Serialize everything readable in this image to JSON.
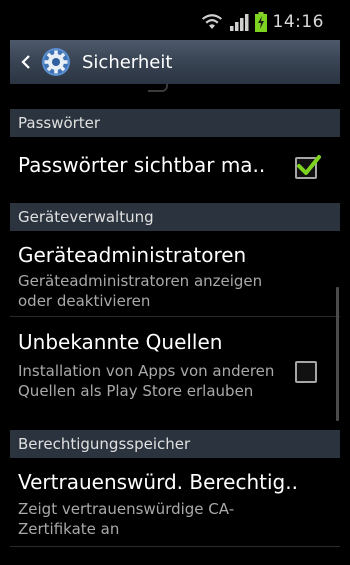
{
  "status_bar": {
    "time": "14:16",
    "icons": [
      "wifi-icon",
      "signal-icon",
      "battery-icon"
    ]
  },
  "action_bar": {
    "title": "Sicherheit",
    "back_icon": "back-icon",
    "app_icon": "gear-icon"
  },
  "sections": [
    {
      "header": "Passwörter"
    },
    {
      "header": "Geräteverwaltung"
    },
    {
      "header": "Berechtigungsspeicher"
    }
  ],
  "prefs": {
    "passwords_visible": {
      "title": "Passwörter sichtbar ma..",
      "checked": true
    },
    "device_admins": {
      "title": "Geräteadministratoren",
      "summary": "Geräteadministratoren anzeigen oder deaktivieren"
    },
    "unknown_sources": {
      "title": "Unbekannte Quellen",
      "summary": "Installation von Apps von anderen Quellen als Play Store erlauben",
      "checked": false
    },
    "trusted_credentials": {
      "title": "Vertrauenswürd. Berechtig..",
      "summary": "Zeigt vertrauenswürdige CA-Zertifikate an"
    }
  },
  "colors": {
    "background": "#000000",
    "section_header_bg": "#2b333e",
    "checkmark": "#7ed321",
    "summary_text": "#a9a9a9"
  }
}
